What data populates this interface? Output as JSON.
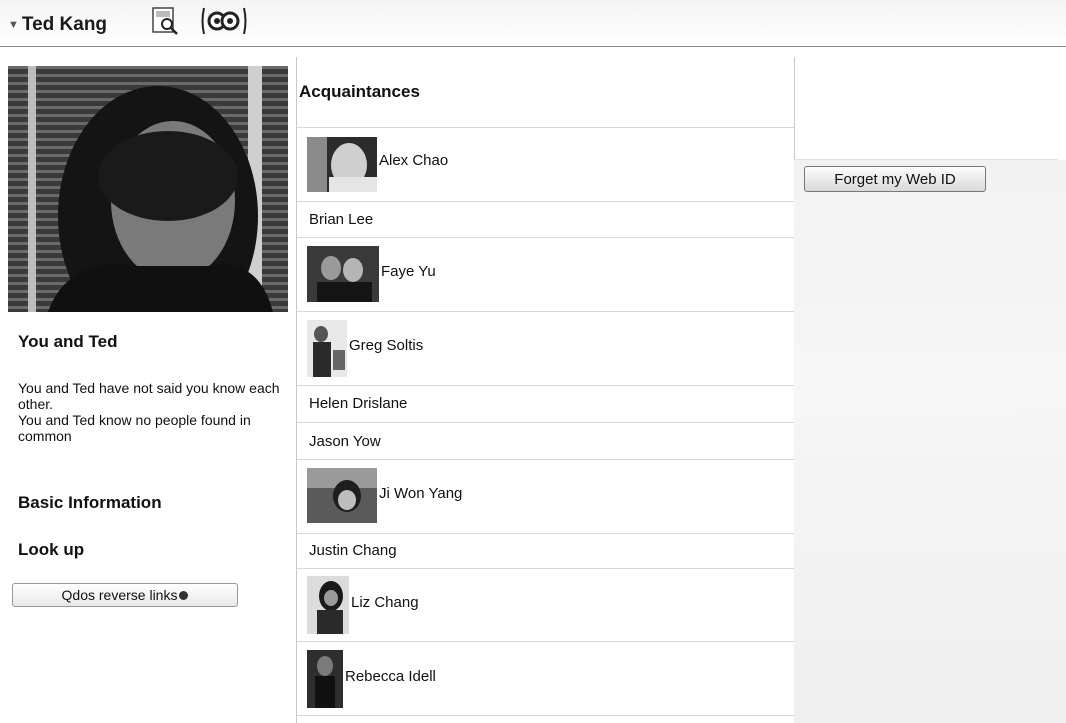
{
  "header": {
    "title": "Ted Kang",
    "icons": [
      "profile-icon",
      "links-icon"
    ]
  },
  "profile": {
    "photo_icon": "person-photo"
  },
  "you_and_ted": {
    "heading": "You and Ted",
    "line1": "You and Ted have not said you know each other.",
    "line2": "You and Ted know no people found in common"
  },
  "basic_info": {
    "heading": "Basic Information"
  },
  "look_up": {
    "heading": "Look up",
    "button_label": "Qdos reverse links"
  },
  "acquaintances": {
    "heading": "Acquaintances",
    "items": [
      {
        "name": "Alex Chao",
        "has_photo": true
      },
      {
        "name": "Brian Lee",
        "has_photo": false
      },
      {
        "name": "Faye Yu",
        "has_photo": true
      },
      {
        "name": "Greg Soltis",
        "has_photo": true
      },
      {
        "name": "Helen Drislane",
        "has_photo": false
      },
      {
        "name": "Jason Yow",
        "has_photo": false
      },
      {
        "name": "Ji Won Yang",
        "has_photo": true
      },
      {
        "name": "Justin Chang",
        "has_photo": false
      },
      {
        "name": "Liz Chang",
        "has_photo": true
      },
      {
        "name": "Rebecca Idell",
        "has_photo": true
      }
    ]
  },
  "right": {
    "forget_button": "Forget my Web ID"
  }
}
